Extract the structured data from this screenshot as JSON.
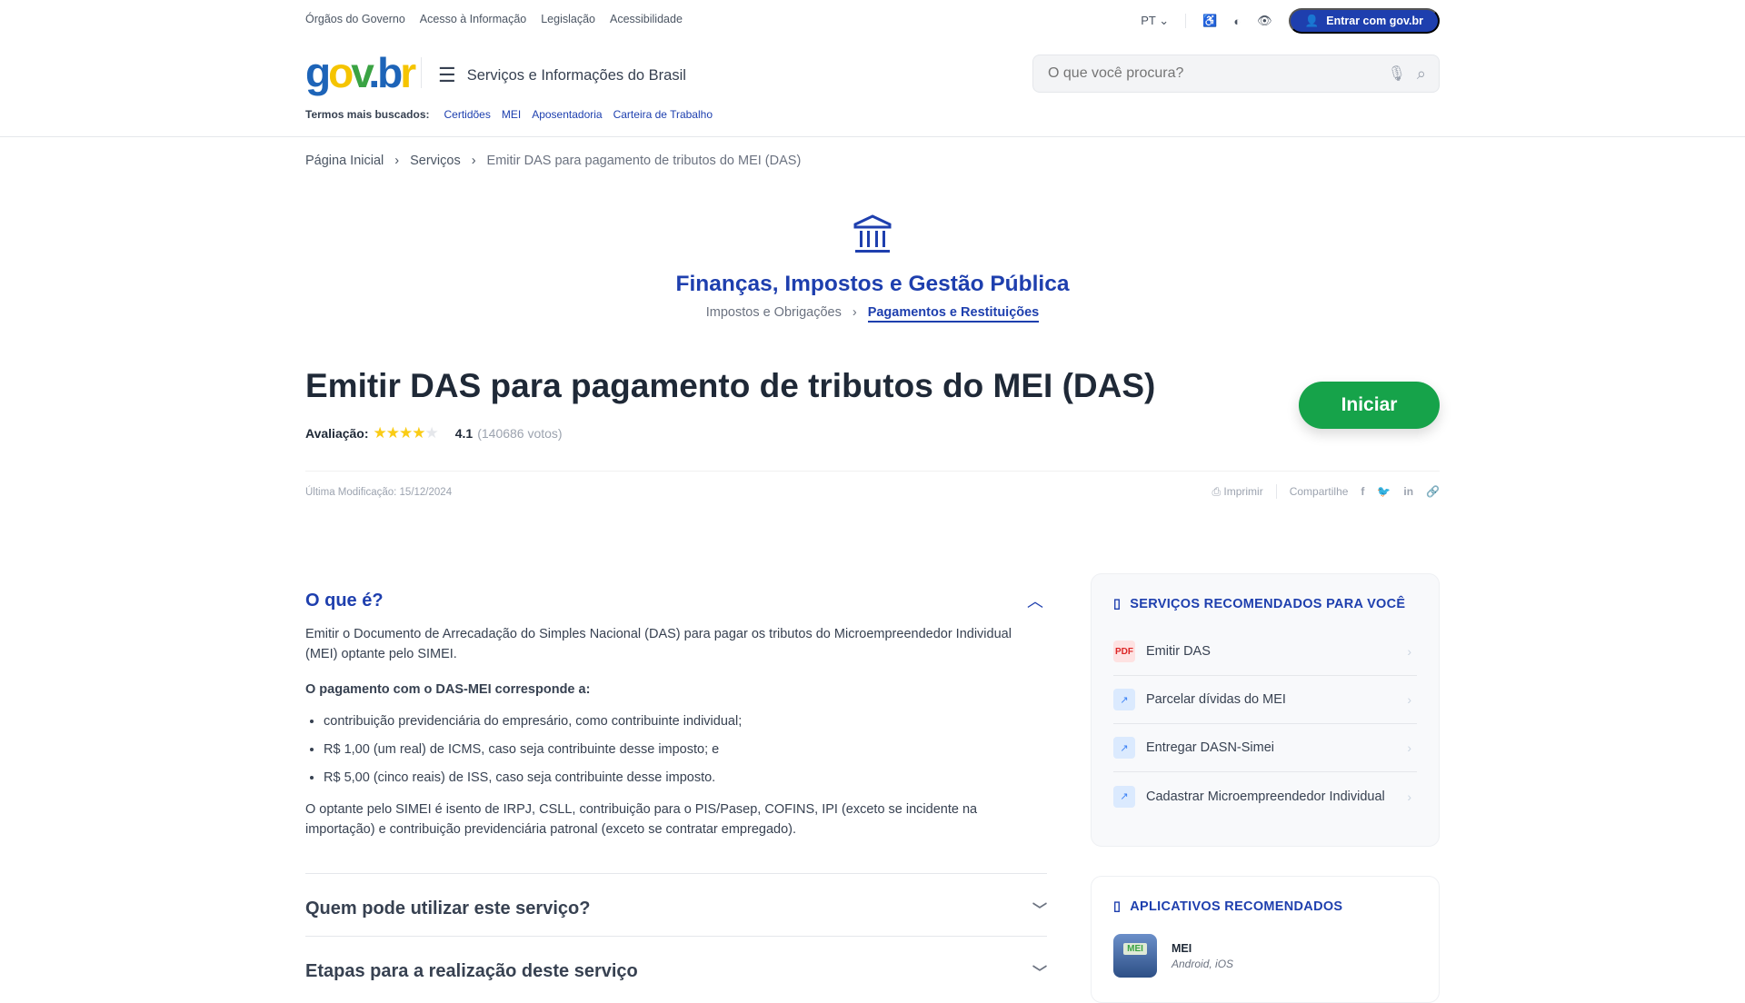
{
  "topbar": {
    "links": [
      "Órgãos do Governo",
      "Acesso à Informação",
      "Legislação",
      "Acessibilidade"
    ],
    "language": "PT",
    "login": "Entrar com gov.br"
  },
  "header": {
    "logo": "gov.br",
    "menu_label": "Serviços e Informações do Brasil",
    "search_placeholder": "O que você procura?",
    "terms_label": "Termos mais buscados:",
    "terms": [
      "Certidões",
      "MEI",
      "Aposentadoria",
      "Carteira de Trabalho"
    ]
  },
  "breadcrumb": [
    "Página Inicial",
    "Serviços",
    "Emitir DAS para pagamento de tributos do MEI (DAS)"
  ],
  "category": {
    "title": "Finanças, Impostos e Gestão Pública",
    "sub": [
      "Impostos e Obrigações",
      "Pagamentos e Restituições"
    ]
  },
  "service": {
    "title": "Emitir DAS para pagamento de tributos do MEI (DAS)",
    "start": "Iniciar",
    "rating_label": "Avaliação:",
    "rating": 4.1,
    "rating_text": "4.1",
    "votes": "(140686 votos)",
    "last_modified": "Última Modificação: 15/12/2024",
    "print": "Imprimir",
    "share": "Compartilhe"
  },
  "content": {
    "heading": "O que é?",
    "p1": "Emitir o Documento de Arrecadação do Simples Nacional (DAS) para pagar os tributos do Microempreendedor Individual (MEI) optante pelo SIMEI.",
    "p2": "O pagamento com o DAS-MEI corresponde a:",
    "bullets": [
      "contribuição previdenciária do empresário, como contribuinte individual;",
      "R$ 1,00 (um real) de ICMS, caso seja contribuinte desse imposto; e",
      "R$ 5,00 (cinco reais) de ISS, caso seja contribuinte desse imposto."
    ],
    "p3": "O optante pelo SIMEI é isento de IRPJ, CSLL, contribuição para o PIS/Pasep, COFINS, IPI (exceto se incidente na importação) e contribuição previdenciária patronal (exceto se contratar empregado).",
    "accordions": [
      "Quem pode utilizar este serviço?",
      "Etapas para a realização deste serviço"
    ]
  },
  "sidebar": {
    "services_title": "SERVIÇOS RECOMENDADOS PARA VOCÊ",
    "services": [
      {
        "label": "Emitir DAS",
        "icon": "PDF"
      },
      {
        "label": "Parcelar dívidas do MEI"
      },
      {
        "label": "Entregar DASN-Simei"
      },
      {
        "label": "Cadastrar Microempreendedor Individual"
      }
    ],
    "apps_title": "APLICATIVOS RECOMENDADOS",
    "apps": [
      {
        "name": "MEI",
        "platforms": "Android, iOS",
        "icon_text": "MEI"
      }
    ]
  }
}
